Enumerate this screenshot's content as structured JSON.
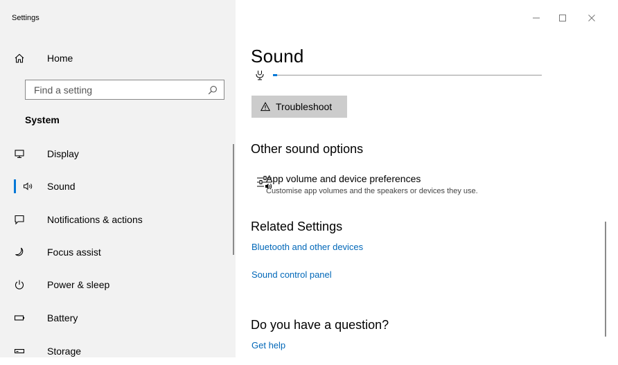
{
  "window": {
    "title": "Settings",
    "controls": {
      "minimize": "—",
      "maximize": "☐",
      "close": "✕"
    }
  },
  "sidebar": {
    "home_label": "Home",
    "search_placeholder": "Find a setting",
    "section_title": "System",
    "items": [
      {
        "label": "Display",
        "icon": "monitor-icon"
      },
      {
        "label": "Sound",
        "icon": "speaker-icon",
        "active": true
      },
      {
        "label": "Notifications & actions",
        "icon": "notification-icon"
      },
      {
        "label": "Focus assist",
        "icon": "moon-icon"
      },
      {
        "label": "Power & sleep",
        "icon": "power-icon"
      },
      {
        "label": "Battery",
        "icon": "battery-icon"
      },
      {
        "label": "Storage",
        "icon": "storage-icon"
      }
    ]
  },
  "main": {
    "page_title": "Sound",
    "troubleshoot_label": "Troubleshoot",
    "other_options_heading": "Other sound options",
    "app_volume": {
      "title": "App volume and device preferences",
      "description": "Customise app volumes and the speakers or devices they use."
    },
    "related_heading": "Related Settings",
    "related_links": [
      "Bluetooth and other devices",
      "Sound control panel"
    ],
    "question_heading": "Do you have a question?",
    "help_link": "Get help"
  },
  "colors": {
    "accent": "#0078d7",
    "link": "#0067b8",
    "sidebar_bg": "#f2f2f2",
    "button_bg": "#cccccc"
  }
}
